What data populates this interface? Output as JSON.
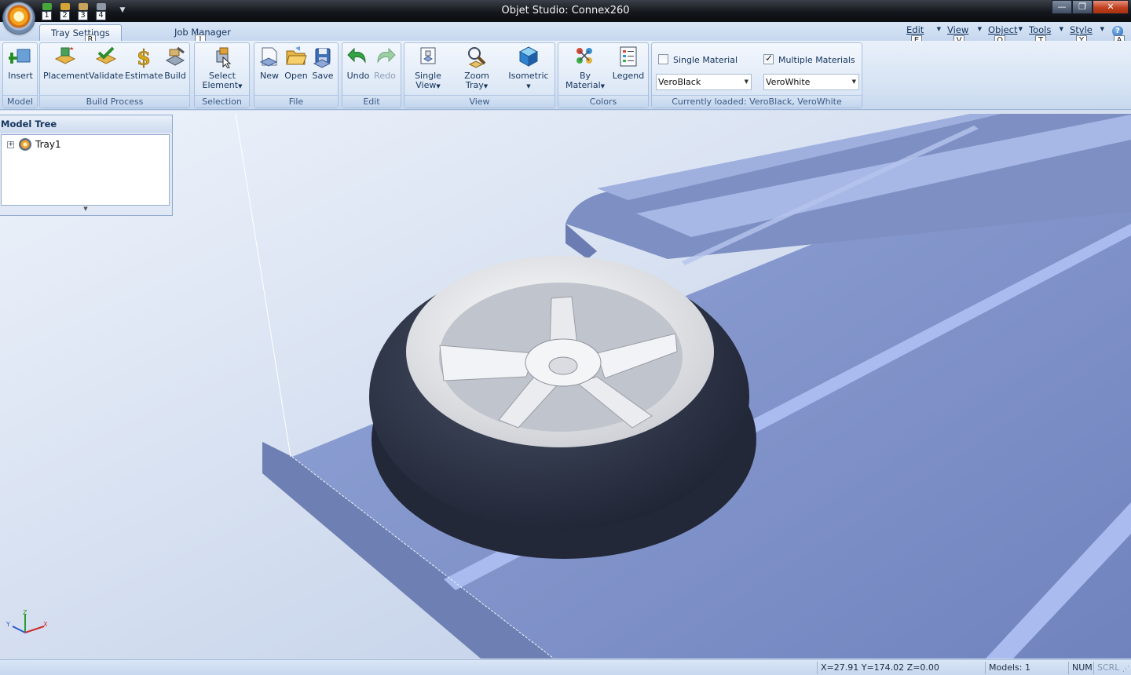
{
  "window": {
    "title": "Objet Studio: Connex260",
    "quick_access": [
      "1",
      "2",
      "3",
      "4"
    ]
  },
  "ribbon": {
    "tabs": [
      {
        "label": "Tray Settings",
        "keytip": "R"
      },
      {
        "label": "Job Manager",
        "keytip": "J"
      }
    ],
    "menus": [
      {
        "label": "Edit",
        "keytip": "E"
      },
      {
        "label": "View",
        "keytip": "V"
      },
      {
        "label": "Object",
        "keytip": "O"
      },
      {
        "label": "Tools",
        "keytip": "T"
      },
      {
        "label": "Style",
        "keytip": "Y"
      }
    ],
    "help_keytip": "A",
    "groups": {
      "model": {
        "label": "Model",
        "insert": "Insert"
      },
      "build": {
        "label": "Build Process",
        "placement": "Placement",
        "validate": "Validate",
        "estimate": "Estimate",
        "build": "Build"
      },
      "selection": {
        "label": "Selection",
        "select_line1": "Select",
        "select_line2": "Element"
      },
      "file": {
        "label": "File",
        "new": "New",
        "open": "Open",
        "save": "Save"
      },
      "edit": {
        "label": "Edit",
        "undo": "Undo",
        "redo": "Redo"
      },
      "view": {
        "label": "View",
        "single_line1": "Single",
        "single_line2": "View",
        "zoom_line1": "Zoom",
        "zoom_line2": "Tray",
        "isometric": "Isometric"
      },
      "colors": {
        "label": "Colors",
        "bymat_line1": "By",
        "bymat_line2": "Material",
        "legend": "Legend"
      },
      "materials": {
        "single_label": "Single Material",
        "single_checked": false,
        "multiple_label": "Multiple Materials",
        "multiple_checked": true,
        "material1": "VeroBlack",
        "material2": "VeroWhite",
        "loaded": "Currently loaded: VeroBlack, VeroWhite"
      }
    }
  },
  "model_tree": {
    "title": "Model Tree",
    "items": [
      {
        "label": "Tray1"
      }
    ]
  },
  "axis_labels": {
    "x": "X",
    "y": "Y",
    "z": "Z"
  },
  "status": {
    "coords": "X=27.91 Y=174.02 Z=0.00",
    "models": "Models: 1",
    "num": "NUM",
    "scrl": "SCRL"
  },
  "colors": {
    "tray": "#7e91c4",
    "background": "#cfdcee",
    "tire": "#2b3243",
    "rim": "#e8e9ec"
  }
}
